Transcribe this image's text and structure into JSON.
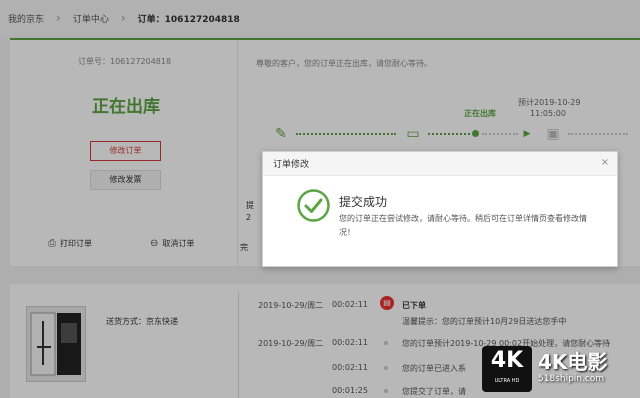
{
  "breadcrumb": {
    "items": [
      "我的京东",
      "订单中心",
      "订单：106127204818"
    ]
  },
  "order_summary": {
    "order_number": "订单号：106127204818",
    "status": "正在出库",
    "modify_button": "修改订单",
    "invoice_button": "修改发票",
    "print_label": "打印订单",
    "cancel_label": "取消订单"
  },
  "tracking": {
    "notice": "尊敬的客户，您的订单正在出库，请您耐心等待。",
    "current_status": "正在出库",
    "date": "预计2019-10-29",
    "time": "11:05:00",
    "partial_lines": [
      "提",
      "2",
      "完"
    ]
  },
  "modal": {
    "title": "订单修改",
    "close": "×",
    "heading": "提交成功",
    "message": "您的订单正在尝试修改，请耐心等待。稍后可在订单详情页查看修改情况！"
  },
  "shipping": {
    "method": "送货方式：京东快递"
  },
  "log": {
    "head": "已下单",
    "rows": [
      {
        "date": "2019-10-29/周二",
        "time": "00:02:11",
        "text": "温馨提示：您的订单预计10月29日送达您手中"
      },
      {
        "date": "2019-10-29/周二",
        "time": "00:02:11",
        "text": "您的订单预计2019-10-29 00:02开始处理，请您耐心等待"
      },
      {
        "date": "",
        "time": "00:02:11",
        "text": "您的订单已进入系"
      },
      {
        "date": "",
        "time": "00:01:25",
        "text": "您提交了订单，请"
      }
    ]
  },
  "watermark": {
    "badge": "4K",
    "badge_sub": "ULTRA HD",
    "brand": "4K电影",
    "url": "518shipin.com"
  },
  "colors": {
    "accent_green": "#5da443",
    "accent_red": "#d43a3a"
  }
}
